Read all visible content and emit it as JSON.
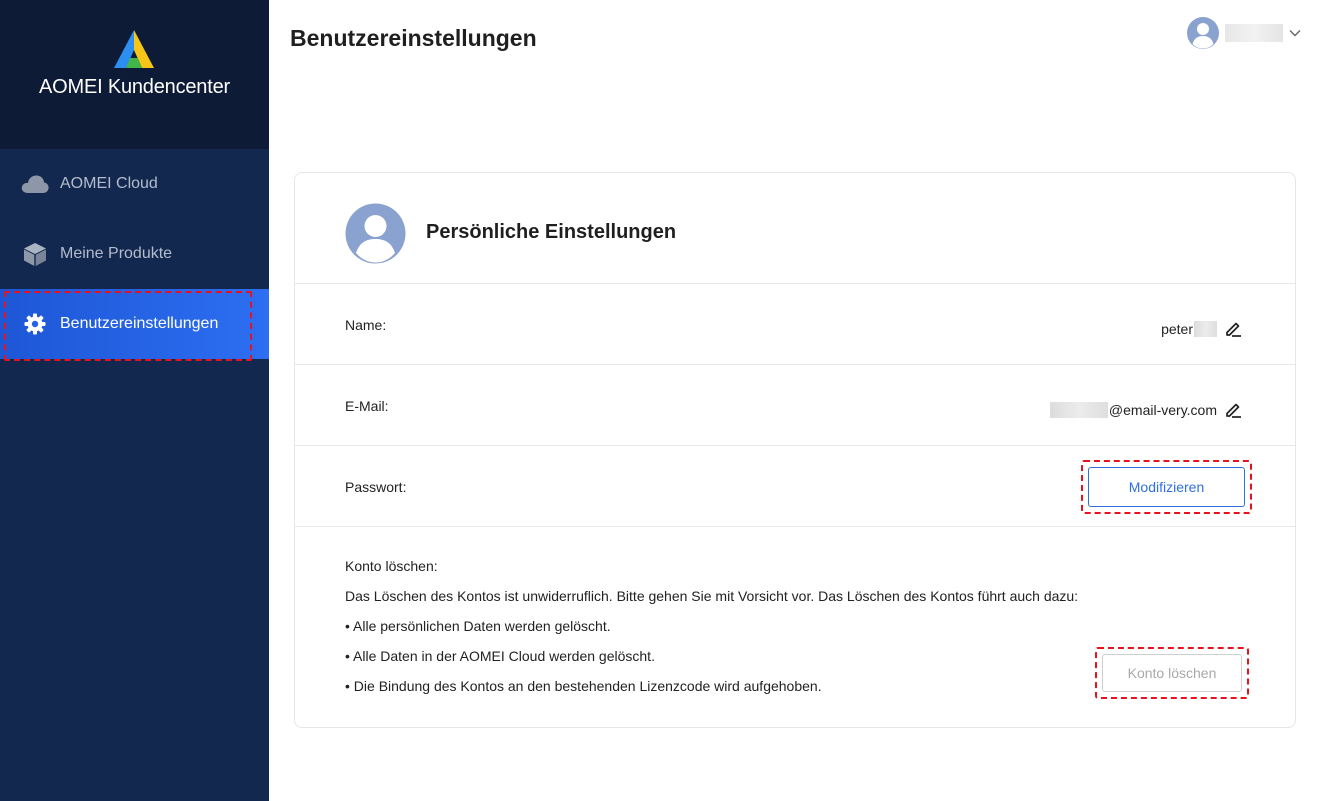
{
  "brand": {
    "name": "AOMEI Kundencenter",
    "logo_icon": "aomei-logo"
  },
  "sidebar": {
    "items": [
      {
        "label": "AOMEI Cloud",
        "icon": "cloud-icon",
        "active": false
      },
      {
        "label": "Meine Produkte",
        "icon": "box-icon",
        "active": false
      },
      {
        "label": "Benutzereinstellungen",
        "icon": "gear-icon",
        "active": true
      }
    ]
  },
  "header": {
    "title": "Benutzereinstellungen",
    "user_icon": "avatar-icon"
  },
  "card": {
    "title": "Persönliche Einstellungen",
    "name": {
      "label": "Name:",
      "value": "peter"
    },
    "email": {
      "label": "E-Mail:",
      "value": "@email-very.com"
    },
    "password": {
      "label": "Passwort:",
      "button": "Modifizieren"
    },
    "delete": {
      "label": "Konto löschen:",
      "warning": "Das Löschen des Kontos ist unwiderruflich. Bitte gehen Sie mit Vorsicht vor. Das Löschen des Kontos führt auch dazu:",
      "bullets": [
        "• Alle persönlichen Daten werden gelöscht.",
        "• Alle Daten in der AOMEI Cloud werden gelöscht.",
        "• Die Bindung des Kontos an den bestehenden Lizenzcode wird aufgehoben."
      ],
      "button": "Konto löschen"
    }
  },
  "colors": {
    "sidebar": "#13284f",
    "brand_bg": "#0d1b36",
    "accent": "#2f6fe0",
    "highlight": "#e8121c"
  }
}
